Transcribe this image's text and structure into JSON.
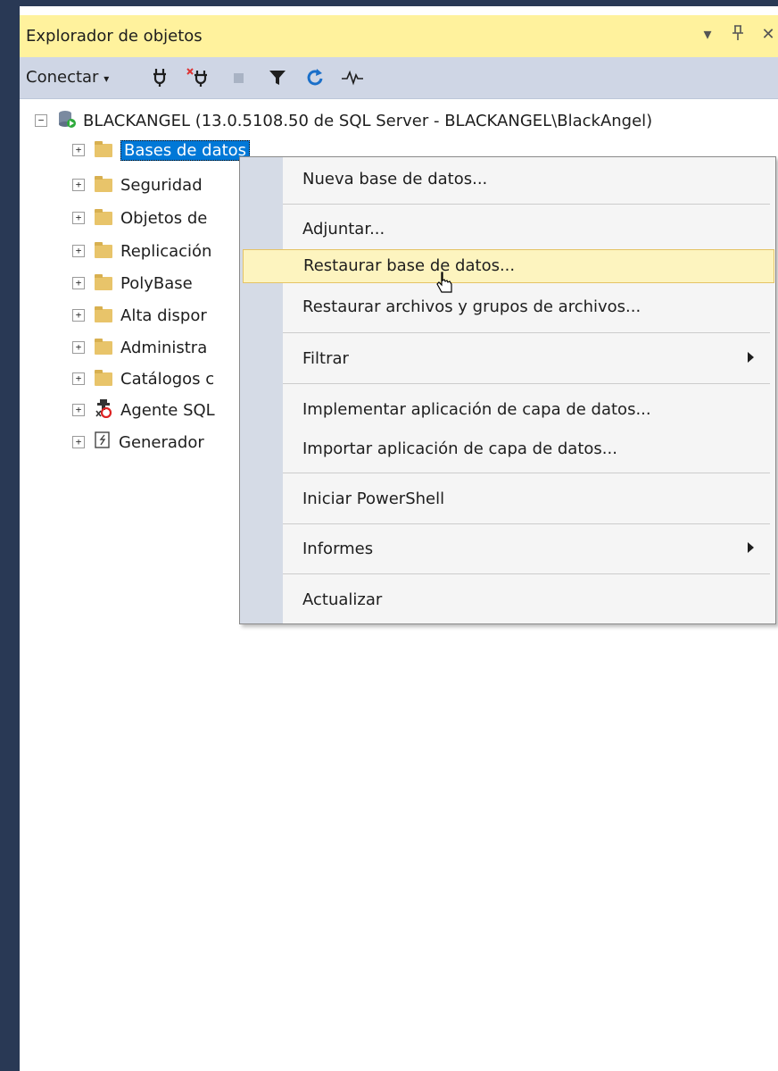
{
  "panel": {
    "title": "Explorador de objetos",
    "title_buttons": [
      "▾",
      "⊥",
      "✕"
    ]
  },
  "toolbar": {
    "connect_label": "Conectar",
    "connect_caret": "▾"
  },
  "tree": {
    "server": "BLACKANGEL (13.0.5108.50 de SQL Server - BLACKANGEL\\BlackAngel)",
    "nodes": [
      "Bases de datos",
      "Seguridad",
      "Objetos de",
      "Replicación",
      "PolyBase",
      "Alta dispor",
      "Administra",
      "Catálogos c",
      "Agente SQL",
      "Generador"
    ]
  },
  "context_menu": {
    "items": [
      {
        "label": "Nueva base de datos..."
      },
      {
        "label": "Adjuntar..."
      },
      {
        "label": "Restaurar base de datos..."
      },
      {
        "label": "Restaurar archivos y grupos de archivos..."
      },
      {
        "label": "Filtrar"
      },
      {
        "label": "Implementar aplicación de capa de datos..."
      },
      {
        "label": "Importar aplicación de capa de datos..."
      },
      {
        "label": "Iniciar PowerShell"
      },
      {
        "label": "Informes"
      },
      {
        "label": "Actualizar"
      }
    ]
  },
  "colors": {
    "title_bar": "#fff29d",
    "toolbar": "#cfd6e5",
    "selection": "#0078d7",
    "menu_hover": "#fdf4bf",
    "frame": "#293955"
  }
}
